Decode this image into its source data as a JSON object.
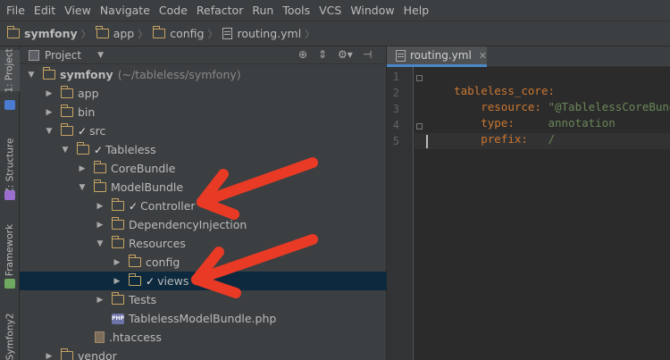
{
  "menu": [
    "File",
    "Edit",
    "View",
    "Navigate",
    "Code",
    "Refactor",
    "Run",
    "Tools",
    "VCS",
    "Window",
    "Help"
  ],
  "breadcrumbs": [
    "symfony",
    "app",
    "config",
    "routing.yml"
  ],
  "toolstrip": [
    "1: Project",
    "Z: Structure",
    "Framework",
    "Symfony2"
  ],
  "project_panel": {
    "title": "Project"
  },
  "tree": [
    {
      "label": "symfony",
      "hint": "(~/tableless/symfony)",
      "bold": true,
      "check": false
    },
    {
      "label": "app",
      "check": false
    },
    {
      "label": "bin",
      "check": false
    },
    {
      "label": "src",
      "check": true
    },
    {
      "label": "Tableless",
      "check": true
    },
    {
      "label": "CoreBundle",
      "check": false
    },
    {
      "label": "ModelBundle",
      "check": false
    },
    {
      "label": "Controller",
      "check": true
    },
    {
      "label": "DependencyInjection",
      "check": false
    },
    {
      "label": "Resources",
      "check": false
    },
    {
      "label": "config",
      "check": false
    },
    {
      "label": "views",
      "check": true,
      "selected": true
    },
    {
      "label": "Tests",
      "check": false
    },
    {
      "label": "TablelessModelBundle.php",
      "check": false
    },
    {
      "label": ".htaccess",
      "check": false
    },
    {
      "label": "vendor",
      "check": false
    }
  ],
  "editor": {
    "tab": "routing.yml",
    "line_numbers": [
      "1",
      "2",
      "3",
      "4",
      "5"
    ],
    "lines": [
      {
        "key": "tableless_core:",
        "val": ""
      },
      {
        "key": "    resource: ",
        "val": "\"@TablelessCoreBundl"
      },
      {
        "key": "    type:     ",
        "val": "annotation"
      },
      {
        "key": "    prefix:   ",
        "val": "/"
      },
      {
        "key": "",
        "val": ""
      }
    ]
  },
  "colors": {
    "arrow": "#e83a25",
    "selection": "#0d293e",
    "folder": "#c8a464",
    "keyword": "#cc7832",
    "string": "#6a8759"
  }
}
